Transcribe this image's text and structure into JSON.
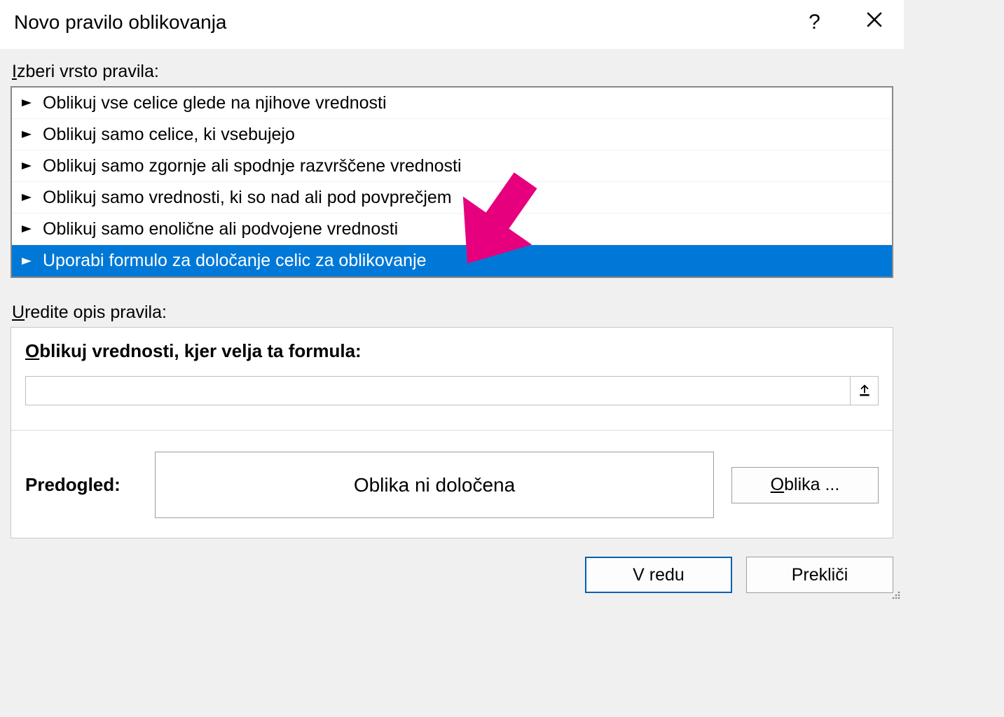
{
  "titlebar": {
    "title": "Novo pravilo oblikovanja"
  },
  "labels": {
    "select_rule_type": "zberi vrsto pravila:",
    "select_rule_type_prefix": "I",
    "edit_rule_desc": "redite opis pravila:",
    "edit_rule_desc_prefix": "U"
  },
  "rule_types": [
    {
      "label": "Oblikuj vse celice glede na njihove vrednosti",
      "selected": false
    },
    {
      "label": "Oblikuj samo celice, ki vsebujejo",
      "selected": false
    },
    {
      "label": "Oblikuj samo zgornje ali spodnje razvrščene vrednosti",
      "selected": false
    },
    {
      "label": "Oblikuj samo vrednosti, ki so nad ali pod povprečjem",
      "selected": false
    },
    {
      "label": "Oblikuj samo enolične ali podvojene vrednosti",
      "selected": false
    },
    {
      "label": "Uporabi formulo za določanje celic za oblikovanje",
      "selected": true
    }
  ],
  "description": {
    "title_prefix": "O",
    "title_rest": "blikuj vrednosti, kjer velja ta formula:",
    "formula_value": "",
    "preview_label": "Predogled:",
    "preview_text": "Oblika ni določena",
    "format_btn_prefix": "O",
    "format_btn_rest": "blika ..."
  },
  "buttons": {
    "ok": "V redu",
    "cancel": "Prekliči"
  },
  "annotation": {
    "arrow_color": "#e6007e"
  }
}
